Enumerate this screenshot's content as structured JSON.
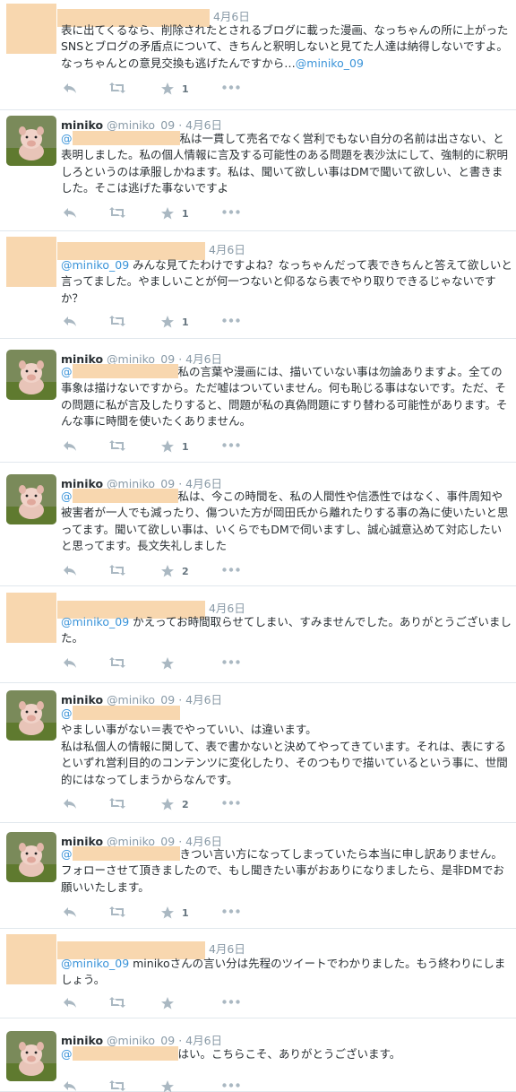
{
  "tweets": [
    {
      "author": "",
      "handle": "",
      "date": "4月6日",
      "text": "表に出てくるなら、削除されたとされるブログに載った漫画、なっちゃんの所に上がったSNSとブログの矛盾点について、きちんと釈明しないと見てた人達は納得しないですよ。なっちゃんとの意見交換も逃げたんですから…",
      "mention_after": "@miniko_09",
      "fav_count": "1"
    },
    {
      "author": "miniko",
      "handle": "@miniko_09",
      "sep": "·",
      "date": "4月6日",
      "mention_before": "@",
      "text": "私は一貫して売名でなく営利でもない自分の名前は出さない、と表明しました。私の個人情報に言及する可能性のある問題を表沙汰にして、強制的に釈明しろというのは承服しかねます。私は、聞いて欲しい事はDMで聞いて欲しい、と書きました。そこは逃げた事ないですよ",
      "fav_count": "1"
    },
    {
      "author": "",
      "date": "4月6日",
      "mention_before": "@miniko_09",
      "text": " みんな見てたわけですよね？なっちゃんだって表できちんと答えて欲しいと言ってました。やましいことが何一つないと仰るなら表でやり取りできるじゃないですか？",
      "fav_count": "1"
    },
    {
      "author": "miniko",
      "handle": "@miniko_09",
      "sep": "·",
      "date": "4月6日",
      "mention_before": "@",
      "text": "私の言葉や漫画には、描いていない事は勿論ありますよ。全ての事象は描けないですから。ただ嘘はついていません。何も恥じる事はないです。ただ、その問題に私が言及したりすると、問題が私の真偽問題にすり替わる可能性があります。そんな事に時間を使いたくありません。",
      "fav_count": "1"
    },
    {
      "author": "miniko",
      "handle": "@miniko_09",
      "sep": "·",
      "date": "4月6日",
      "mention_before": "@",
      "text": "私は、今この時間を、私の人間性や信憑性ではなく、事件周知や被害者が一人でも減ったり、傷ついた方が岡田氏から離れたりする事の為に使いたいと思ってます。聞いて欲しい事は、いくらでもDMで伺いますし、誠心誠意込めて対応したいと思ってます。長文失礼しました",
      "fav_count": "2"
    },
    {
      "author": "",
      "date": "4月6日",
      "mention_before": "@miniko_09",
      "text": " かえってお時間取らせてしまい、すみませんでした。ありがとうございました。",
      "fav_count": ""
    },
    {
      "author": "miniko",
      "handle": "@miniko_09",
      "sep": "·",
      "date": "4月6日",
      "mention_before": "@",
      "text_lines": [
        "やましい事がない＝表でやっていい、は違います。",
        "私は私個人の情報に関して、表で書かないと決めてやってきています。それは、表にするといずれ営利目的のコンテンツに変化したり、そのつもりで描いているという事に、世間的にはなってしまうからなんです。"
      ],
      "fav_count": "2"
    },
    {
      "author": "miniko",
      "handle": "@miniko_09",
      "sep": "·",
      "date": "4月6日",
      "mention_before": "@",
      "text": "きつい言い方になってしまっていたら本当に申し訳ありません。フォローさせて頂きましたので、もし聞きたい事がおありになりましたら、是非DMでお願いいたします。",
      "fav_count": "1"
    },
    {
      "author": "",
      "date": "4月6日",
      "mention_before": "@miniko_09",
      "text": " minikoさんの言い分は先程のツイートでわかりました。もう終わりにしましょう。",
      "fav_count": ""
    },
    {
      "author": "miniko",
      "handle": "@miniko_09",
      "sep": "·",
      "date": "4月6日",
      "mention_before": "@",
      "text": "はい。こちらこそ、ありがとうございます。",
      "fav_count": ""
    }
  ],
  "icons": [
    "reply-icon",
    "retweet-icon",
    "favorite-icon",
    "more-icon"
  ],
  "colors": {
    "link": "#3b94d9",
    "meta": "#8899a6",
    "redaction": "#f8d7af",
    "border": "#e1e8ed"
  }
}
